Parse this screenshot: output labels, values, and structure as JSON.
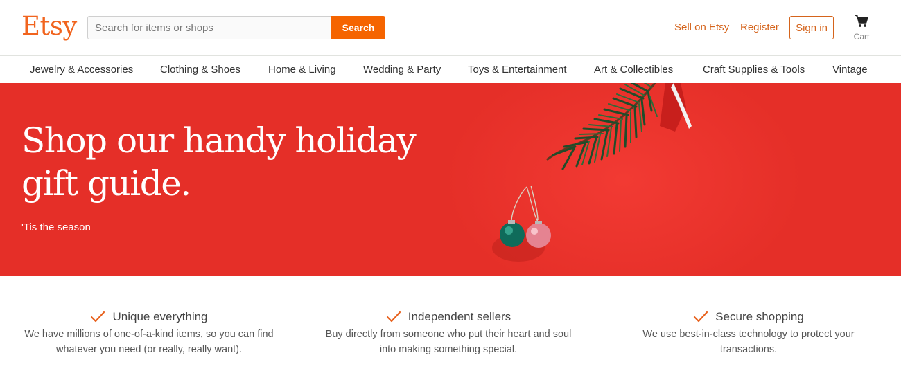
{
  "header": {
    "logo": "Etsy",
    "search": {
      "placeholder": "Search for items or shops",
      "button_label": "Search"
    },
    "links": {
      "sell": "Sell on Etsy",
      "register": "Register",
      "signin": "Sign in"
    },
    "cart_label": "Cart"
  },
  "categories": [
    "Jewelry & Accessories",
    "Clothing & Shoes",
    "Home & Living",
    "Wedding & Party",
    "Toys & Entertainment",
    "Art & Collectibles",
    "Craft Supplies & Tools",
    "Vintage"
  ],
  "hero": {
    "title": "Shop our handy holiday gift guide.",
    "subtitle": "'Tis the season"
  },
  "value_props": [
    {
      "title": "Unique everything",
      "description": "We have millions of one-of-a-kind items, so you can find whatever you need (or really, really want).",
      "icon": "checkmark-icon"
    },
    {
      "title": "Independent sellers",
      "description": "Buy directly from someone who put their heart and soul into making something special.",
      "icon": "checkmark-icon"
    },
    {
      "title": "Secure shopping",
      "description": "We use best-in-class technology to protect your transactions.",
      "icon": "checkmark-icon"
    }
  ],
  "colors": {
    "brand_orange": "#f1641e",
    "search_button": "#f56400",
    "link_orange": "#d5641c",
    "hero_red": "#e52f28",
    "check_orange": "#e8621e"
  }
}
